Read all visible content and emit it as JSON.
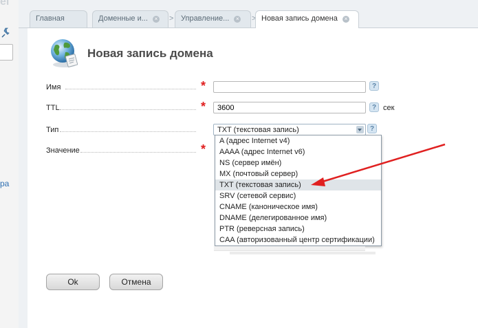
{
  "left_panel": {
    "faded_letter": "el",
    "partial_link": "ра"
  },
  "tabs": [
    {
      "label": "Главная",
      "closable": false,
      "active": false
    },
    {
      "label": "Доменные и...",
      "closable": true,
      "active": false
    },
    {
      "label": "Управление...",
      "closable": true,
      "active": false
    },
    {
      "label": "Новая запись домена",
      "closable": true,
      "active": true
    }
  ],
  "breadcrumb_separator": ">",
  "tab_close_glyph": "×",
  "page": {
    "title": "Новая запись домена",
    "icon": "globe-icon"
  },
  "form": {
    "name": {
      "label": "Имя",
      "value": ""
    },
    "ttl": {
      "label": "TTL",
      "value": "3600",
      "unit": "сек"
    },
    "type": {
      "label": "Тип",
      "selected": "TXT (текстовая запись)"
    },
    "value": {
      "label": "Значение"
    },
    "required_mark": "*",
    "help_mark": "?"
  },
  "type_options": [
    "A (адрес Internet v4)",
    "AAAA (адрес Internet v6)",
    "NS (сервер имён)",
    "MX (почтовый сервер)",
    "TXT (текстовая запись)",
    "SRV (сетевой сервис)",
    "CNAME (каноническое имя)",
    "DNAME (делегированное имя)",
    "PTR (реверсная запись)",
    "CAA (авторизованный центр сертификации)"
  ],
  "selected_option_index": 4,
  "buttons": {
    "ok": "Ok",
    "cancel": "Отмена"
  },
  "colors": {
    "annotation_arrow": "#e02020",
    "required": "#e02020",
    "link": "#2f6fb2"
  }
}
